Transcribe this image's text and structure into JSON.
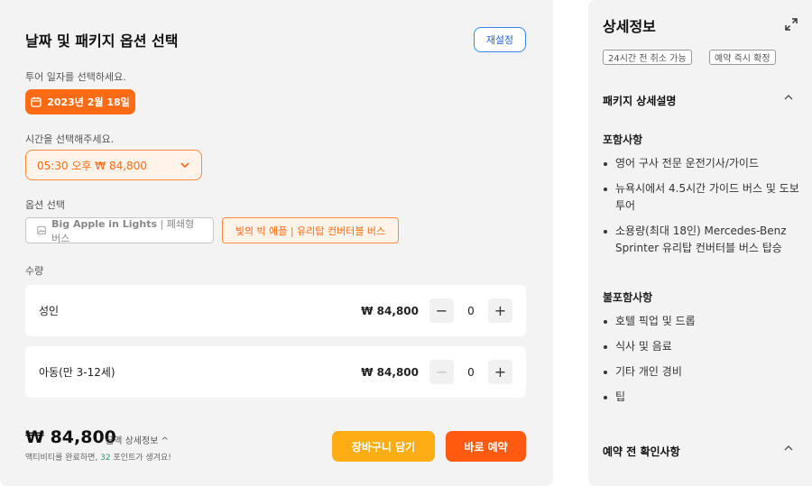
{
  "left": {
    "title": "날짜 및 패키지 옵션 선택",
    "reset_label": "재설정",
    "date_prompt": "투어 일자를 선택하세요.",
    "date_value": "2023년 2월 18일",
    "time_prompt": "시간을 선택해주세요.",
    "time_value": "05:30 오후 ₩ 84,800",
    "option_prompt": "옵션 선택",
    "options": [
      {
        "title": "Big Apple in Lights",
        "sub": " | 폐쇄형 버스"
      },
      {
        "label": "빛의 빅 애플 | 유리탑 컨버터블 버스"
      }
    ],
    "qty_prompt": "수량",
    "rows": [
      {
        "name": "성인",
        "price": "₩ 84,800",
        "minus": "−",
        "qty": "0",
        "plus": "+"
      },
      {
        "name": "아동(만 3-12세)",
        "price": "₩ 84,800",
        "minus": "−",
        "qty": "0",
        "plus": "+"
      }
    ],
    "total_price": "₩ 84,800",
    "total_detail": "금액 상세정보 ^",
    "points_pre": "액티비티를 완료하면, ",
    "points_num": "32",
    "points_post": " 포인트가 생겨요!",
    "cart_label": "장바구니 담기",
    "book_label": "바로 예약"
  },
  "right": {
    "title": "상세정보",
    "tags": [
      "24시간 전 취소 가능",
      "예약 즉시 확정"
    ],
    "package_heading": "패키지 상세설명",
    "included_heading": "포함사항",
    "included": [
      "영어 구사 전문 운전기사/가이드",
      "뉴욕시에서 4.5시간 가이드 버스 및 도보 투어",
      "소용량(최대 18인) Mercedes-Benz Sprinter 유리탑 컨버터블 버스 탑승"
    ],
    "excluded_heading": "불포함사항",
    "excluded": [
      "호텔 픽업 및 드롭",
      "식사 및 음료",
      "기타 개인 경비",
      "팁"
    ],
    "precheck_heading": "예약 전 확인사항"
  },
  "colors": {
    "accent": "#ff6a13",
    "cart": "#ffad14",
    "book": "#ff5a0f",
    "link": "#2563eb",
    "points": "#22a06b"
  }
}
